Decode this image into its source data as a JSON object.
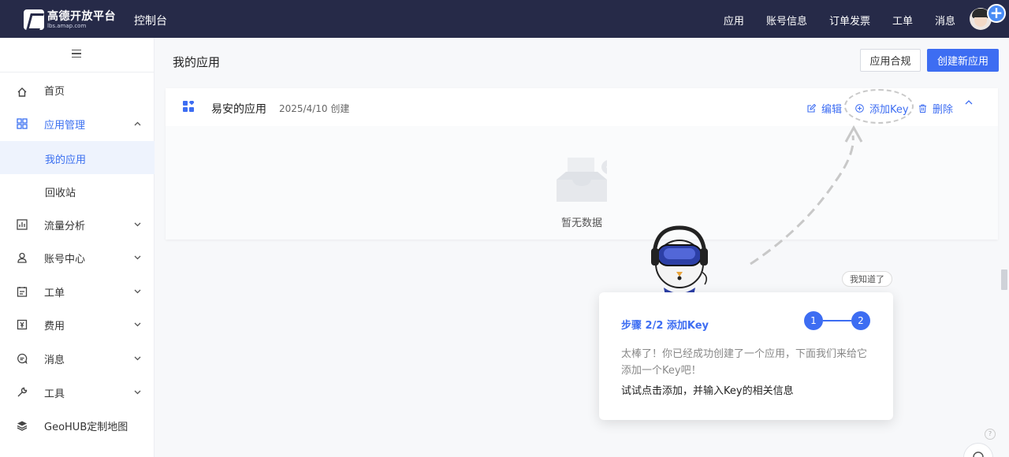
{
  "header": {
    "logo_main": "高德开放平台",
    "logo_sub": "lbs.amap.com",
    "console": "控制台",
    "nav": [
      "应用",
      "账号信息",
      "订单发票",
      "工单",
      "消息"
    ],
    "plus": "+"
  },
  "sidebar": {
    "items": [
      {
        "label": "首页",
        "icon": "home-icon"
      },
      {
        "label": "应用管理",
        "icon": "app-grid-icon",
        "chevron": "^"
      },
      {
        "label": "我的应用"
      },
      {
        "label": "回收站"
      },
      {
        "label": "流量分析",
        "icon": "chart-icon",
        "chevron": "v"
      },
      {
        "label": "账号中心",
        "icon": "user-icon",
        "chevron": "v"
      },
      {
        "label": "工单",
        "icon": "ticket-icon",
        "chevron": "v"
      },
      {
        "label": "费用",
        "icon": "billing-icon",
        "chevron": "v"
      },
      {
        "label": "消息",
        "icon": "message-icon",
        "chevron": "v"
      },
      {
        "label": "工具",
        "icon": "wrench-icon",
        "chevron": "v"
      },
      {
        "label": "GeoHUB定制地图",
        "icon": "layers-icon"
      }
    ]
  },
  "main": {
    "title": "我的应用",
    "compliance_label": "应用合规",
    "create_label": "创建新应用",
    "app": {
      "name": "易安的应用",
      "created": "2025/4/10 创建",
      "edit": "编辑",
      "add_key": "添加Key",
      "delete": "删除",
      "collapse": "^",
      "empty": "暂无数据"
    }
  },
  "guide": {
    "dismiss": "我知道了",
    "step_title": "步骤 2/2 添加Key",
    "step1": "1",
    "step2": "2",
    "desc": "太棒了！你已经成功创建了一个应用，下面我们来给它添加一个Key吧！",
    "action": "试试点击添加，并输入Key的相关信息"
  },
  "colors": {
    "header_bg": "#262a48",
    "accent": "#3d6df2"
  }
}
